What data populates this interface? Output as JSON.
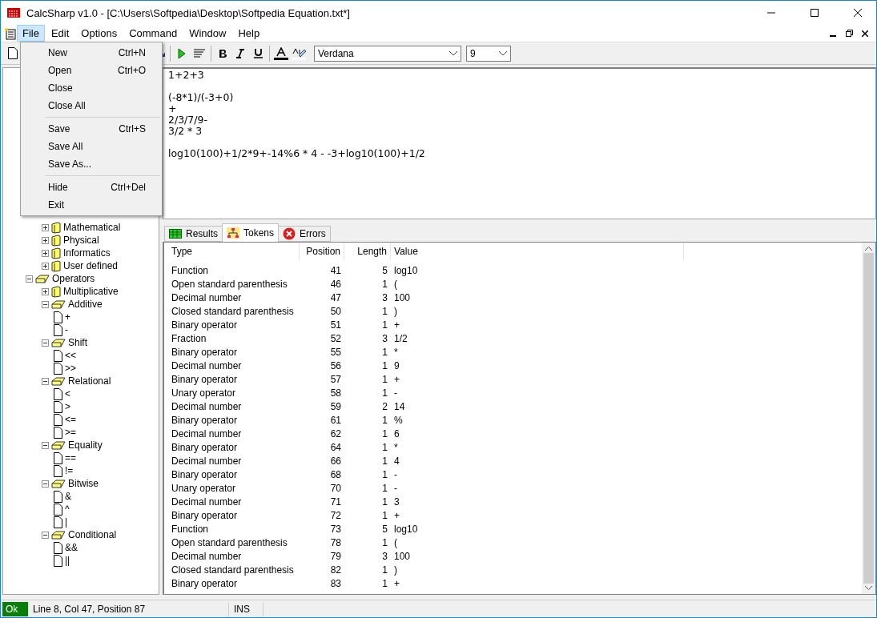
{
  "window": {
    "title": "CalcSharp v1.0 - [C:\\Users\\Softpedia\\Desktop\\Softpedia Equation.txt*]"
  },
  "menubar": [
    {
      "label": "File",
      "selected": true
    },
    {
      "label": "Edit",
      "selected": false
    },
    {
      "label": "Options",
      "selected": false
    },
    {
      "label": "Command",
      "selected": false
    },
    {
      "label": "Window",
      "selected": false
    },
    {
      "label": "Help",
      "selected": false
    }
  ],
  "file_menu": [
    {
      "kind": "item",
      "label": "New",
      "shortcut": "Ctrl+N"
    },
    {
      "kind": "item",
      "label": "Open",
      "shortcut": "Ctrl+O"
    },
    {
      "kind": "item",
      "label": "Close"
    },
    {
      "kind": "item",
      "label": "Close All"
    },
    {
      "kind": "separator"
    },
    {
      "kind": "item",
      "label": "Save",
      "shortcut": "Ctrl+S"
    },
    {
      "kind": "item",
      "label": "Save All"
    },
    {
      "kind": "item",
      "label": "Save As..."
    },
    {
      "kind": "separator"
    },
    {
      "kind": "item",
      "label": "Hide",
      "shortcut": "Ctrl+Del"
    },
    {
      "kind": "item",
      "label": "Exit"
    }
  ],
  "toolbar": {
    "font": "Verdana",
    "size": "9"
  },
  "tree": [
    {
      "children": [
        {
          "label": "Mathematical",
          "expanded": false
        },
        {
          "label": "Physical",
          "expanded": false
        },
        {
          "label": "Informatics",
          "expanded": false
        },
        {
          "label": "User defined",
          "expanded": false
        }
      ]
    },
    {
      "label": "Operators",
      "expanded": true,
      "children": [
        {
          "label": "Multiplicative",
          "expanded": false
        },
        {
          "label": "Additive",
          "expanded": true,
          "children": [
            {
              "label": "+"
            },
            {
              "label": "-"
            }
          ]
        },
        {
          "label": "Shift",
          "expanded": true,
          "children": [
            {
              "label": "<<"
            },
            {
              "label": ">>"
            }
          ]
        },
        {
          "label": "Relational",
          "expanded": true,
          "children": [
            {
              "label": "<"
            },
            {
              "label": ">"
            },
            {
              "label": "<="
            },
            {
              "label": ">="
            }
          ]
        },
        {
          "label": "Equality",
          "expanded": true,
          "children": [
            {
              "label": "=="
            },
            {
              "label": "!="
            }
          ]
        },
        {
          "label": "Bitwise",
          "expanded": true,
          "children": [
            {
              "label": "&"
            },
            {
              "label": "^"
            },
            {
              "label": "|"
            }
          ]
        },
        {
          "label": "Conditional",
          "expanded": true,
          "children": [
            {
              "label": "&&"
            },
            {
              "label": "||"
            }
          ]
        }
      ]
    }
  ],
  "editor": {
    "text": "1+2+3\n\n(-8*1)/(-3+0)\n+\n2/3/7/9-\n3/2 * 3\n\nlog10(100)+1/2*9+-14%6 * 4 - -3+log10(100)+1/2"
  },
  "tabs": [
    {
      "label": "Results",
      "kind": "results",
      "selected": false
    },
    {
      "label": "Tokens",
      "kind": "tokens",
      "selected": true
    },
    {
      "label": "Errors",
      "kind": "errors",
      "selected": false
    }
  ],
  "table": {
    "columns": [
      "Type",
      "Position",
      "Length",
      "Value"
    ],
    "rows": [
      [
        "Function",
        "41",
        "5",
        "log10"
      ],
      [
        "Open standard parenthesis",
        "46",
        "1",
        "("
      ],
      [
        "Decimal number",
        "47",
        "3",
        "100"
      ],
      [
        "Closed standard parenthesis",
        "50",
        "1",
        ")"
      ],
      [
        "Binary operator",
        "51",
        "1",
        "+"
      ],
      [
        "Fraction",
        "52",
        "3",
        "1/2"
      ],
      [
        "Binary operator",
        "55",
        "1",
        "*"
      ],
      [
        "Decimal number",
        "56",
        "1",
        "9"
      ],
      [
        "Binary operator",
        "57",
        "1",
        "+"
      ],
      [
        "Unary operator",
        "58",
        "1",
        "-"
      ],
      [
        "Decimal number",
        "59",
        "2",
        "14"
      ],
      [
        "Binary operator",
        "61",
        "1",
        "%"
      ],
      [
        "Decimal number",
        "62",
        "1",
        "6"
      ],
      [
        "Binary operator",
        "64",
        "1",
        "*"
      ],
      [
        "Decimal number",
        "66",
        "1",
        "4"
      ],
      [
        "Binary operator",
        "68",
        "1",
        "-"
      ],
      [
        "Unary operator",
        "70",
        "1",
        "-"
      ],
      [
        "Decimal number",
        "71",
        "1",
        "3"
      ],
      [
        "Binary operator",
        "72",
        "1",
        "+"
      ],
      [
        "Function",
        "73",
        "5",
        "log10"
      ],
      [
        "Open standard parenthesis",
        "78",
        "1",
        "("
      ],
      [
        "Decimal number",
        "79",
        "3",
        "100"
      ],
      [
        "Closed standard parenthesis",
        "82",
        "1",
        ")"
      ],
      [
        "Binary operator",
        "83",
        "1",
        "+"
      ]
    ]
  },
  "status_bar": {
    "state": "Ok",
    "position": "Line 8, Col 47, Position 87",
    "mode": "INS"
  }
}
